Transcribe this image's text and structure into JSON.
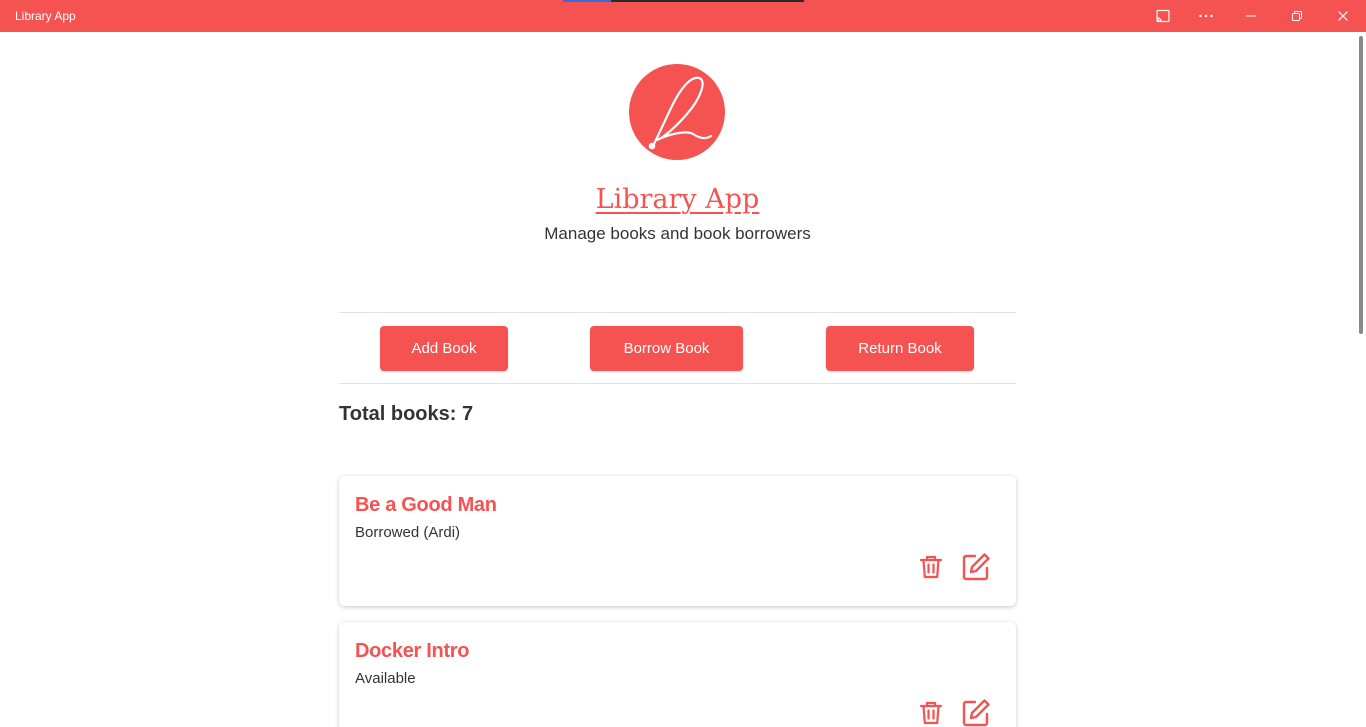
{
  "window": {
    "title": "Library App",
    "accent_color": "#f55252",
    "controls": [
      "cast-icon",
      "more-icon",
      "minimize-icon",
      "restore-icon",
      "close-icon"
    ]
  },
  "header": {
    "logo_icon": "cursive-l-logo",
    "title": "Library App",
    "subtitle": "Manage books and book borrowers"
  },
  "actions": {
    "add_label": "Add Book",
    "borrow_label": "Borrow Book",
    "return_label": "Return Book"
  },
  "summary": {
    "total_text": "Total books: 7"
  },
  "books": [
    {
      "title": "Be a Good Man",
      "status": "Borrowed (Ardi)"
    },
    {
      "title": "Docker Intro",
      "status": "Available"
    }
  ]
}
